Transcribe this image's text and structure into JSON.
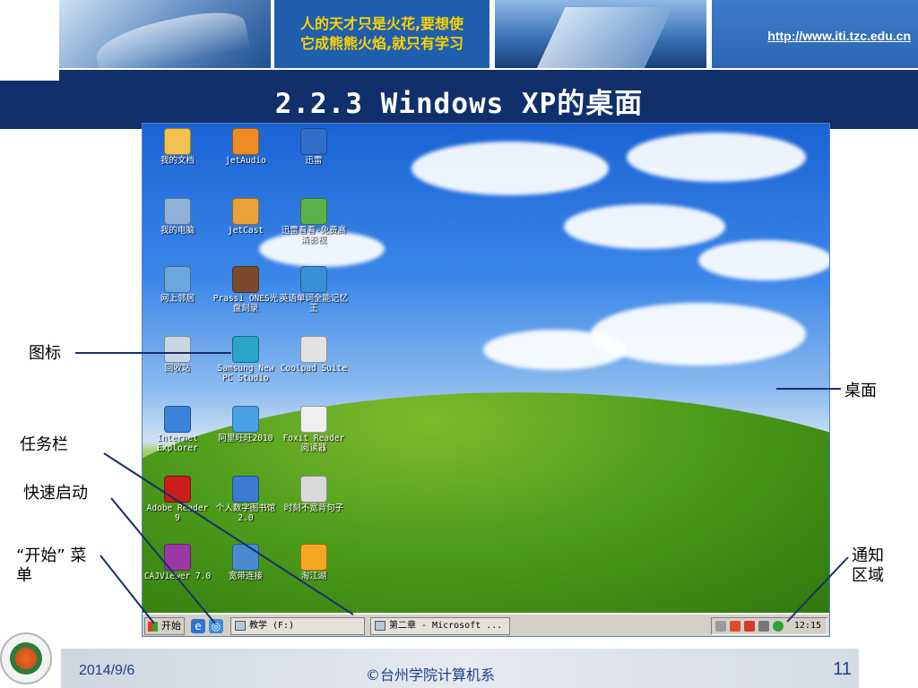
{
  "header": {
    "quote_line1": "人的天才只是火花,要想使",
    "quote_line2": "它成熊熊火焰,就只有学习",
    "url": "http://www.iti.tzc.edu.cn"
  },
  "slide": {
    "title": "2.2.3 Windows XP的桌面"
  },
  "desktop": {
    "icons": [
      {
        "label": "我的文档",
        "icon": "my-documents-icon",
        "color": "#f2c14e"
      },
      {
        "label": "jetAudio",
        "icon": "jetaudio-icon",
        "color": "#f08a24"
      },
      {
        "label": "迅雷",
        "icon": "thunder-icon",
        "color": "#2f6fc9"
      },
      {
        "label": "我的电脑",
        "icon": "my-computer-icon",
        "color": "#8fb1d9"
      },
      {
        "label": "jetCast",
        "icon": "jetcast-icon",
        "color": "#e9a23b"
      },
      {
        "label": "迅雷看看-免费高清影视",
        "icon": "xunlei-kankan-icon",
        "color": "#5ab04b"
      },
      {
        "label": "网上邻居",
        "icon": "network-neighborhood-icon",
        "color": "#6aa7de"
      },
      {
        "label": "Prassi ONES光盘刻录",
        "icon": "ones-burner-icon",
        "color": "#7a4a2a"
      },
      {
        "label": "英语单词全能记忆王",
        "icon": "english-words-icon",
        "color": "#3b8fd6"
      },
      {
        "label": "回收站",
        "icon": "recycle-bin-icon",
        "color": "#c9d6e3"
      },
      {
        "label": "Samsung New PC Studio",
        "icon": "samsung-pc-studio-icon",
        "color": "#2aa4c9"
      },
      {
        "label": "Coolpad Suite",
        "icon": "coolpad-suite-icon",
        "color": "#e2e2e2"
      },
      {
        "label": "Internet Explorer",
        "icon": "internet-explorer-icon",
        "color": "#3b83d6"
      },
      {
        "label": "阿里旺旺2010",
        "icon": "aliwangwang-icon",
        "color": "#4aa0e6"
      },
      {
        "label": "Foxit Reader 阅读器",
        "icon": "foxit-reader-icon",
        "color": "#f0f0f0"
      },
      {
        "label": "Adobe Reader 9",
        "icon": "adobe-reader-icon",
        "color": "#c81d1d"
      },
      {
        "label": "个人数字图书馆2.0",
        "icon": "digital-library-icon",
        "color": "#3b7bd0"
      },
      {
        "label": "时刻不宽背句子",
        "icon": "sentence-app-icon",
        "color": "#d9d9d9"
      },
      {
        "label": "CAJViewer 7.0",
        "icon": "cajviewer-icon",
        "color": "#9b3aa6"
      },
      {
        "label": "宽带连接",
        "icon": "broadband-connection-icon",
        "color": "#4a8bd0"
      },
      {
        "label": "淘江湖",
        "icon": "taojianghu-icon",
        "color": "#f5a623"
      }
    ],
    "taskbar": {
      "start_label": "开始",
      "quick_launch": [
        {
          "icon": "ie-quicklaunch-icon",
          "glyph": "e",
          "color": "#2f75cf"
        },
        {
          "icon": "show-desktop-icon",
          "glyph": "◎",
          "color": "#3d8fd8"
        }
      ],
      "tasks": [
        {
          "label": "教学 (F:)",
          "icon": "drive-icon"
        },
        {
          "label": "第二章 - Microsoft ...",
          "icon": "word-document-icon"
        }
      ],
      "tray_icons": [
        {
          "icon": "keyboard-tray-icon",
          "color": "#9a9a9a"
        },
        {
          "icon": "app-tray-icon",
          "color": "#e04b2b"
        },
        {
          "icon": "security-tray-icon",
          "color": "#d13a2f"
        },
        {
          "icon": "volume-tray-icon",
          "color": "#777777"
        },
        {
          "icon": "network-tray-icon",
          "color": "#2fa33a"
        }
      ],
      "clock": "12:15"
    }
  },
  "annotations": {
    "icon": "图标",
    "taskbar": "任务栏",
    "quick_launch": "快速启动",
    "start_menu_line1": "“开始” 菜",
    "start_menu_line2": "单",
    "desktop": "桌面",
    "notification_line1": "通知",
    "notification_line2": "区域"
  },
  "footer": {
    "date": "2014/9/6",
    "copyright": "©台州学院计算机系",
    "page": "11"
  }
}
